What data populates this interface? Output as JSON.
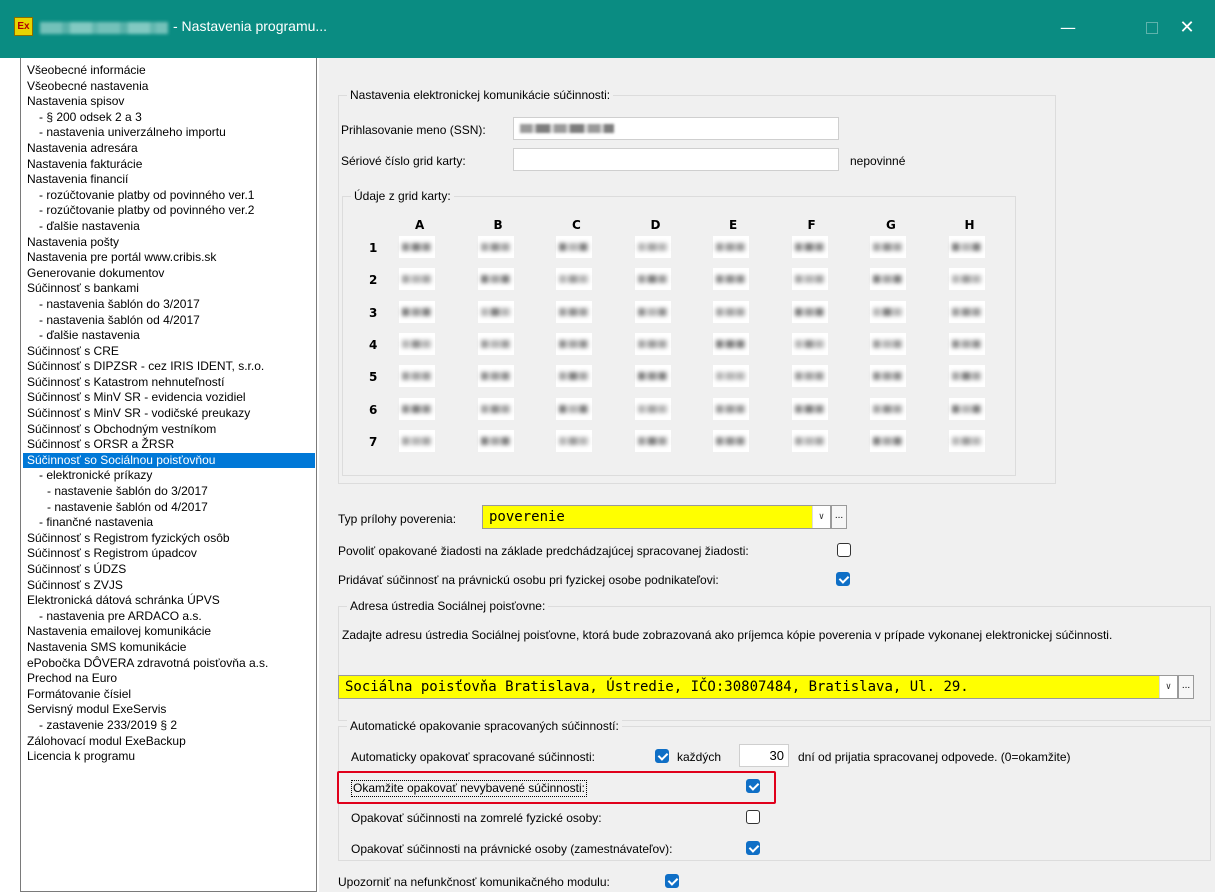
{
  "window": {
    "title": "- Nastavenia programu...",
    "app_icon_text": "Ex",
    "buttons": {
      "minimize": "—",
      "close": "✕"
    }
  },
  "tree": {
    "items": [
      {
        "label": "Všeobecné informácie",
        "level": 0
      },
      {
        "label": "Všeobecné nastavenia",
        "level": 0
      },
      {
        "label": "Nastavenia spisov",
        "level": 0
      },
      {
        "label": "- § 200 odsek 2 a 3",
        "level": 1
      },
      {
        "label": "- nastavenia univerzálneho importu",
        "level": 1
      },
      {
        "label": "Nastavenia adresára",
        "level": 0
      },
      {
        "label": "Nastavenia fakturácie",
        "level": 0
      },
      {
        "label": "Nastavenia financií",
        "level": 0
      },
      {
        "label": "- rozúčtovanie platby od povinného ver.1",
        "level": 1
      },
      {
        "label": "- rozúčtovanie platby od povinného ver.2",
        "level": 1
      },
      {
        "label": "- ďalšie nastavenia",
        "level": 1
      },
      {
        "label": "Nastavenia pošty",
        "level": 0
      },
      {
        "label": "Nastavenia pre portál www.cribis.sk",
        "level": 0
      },
      {
        "label": "Generovanie dokumentov",
        "level": 0
      },
      {
        "label": "Súčinnosť s bankami",
        "level": 0
      },
      {
        "label": "- nastavenia šablón do 3/2017",
        "level": 1
      },
      {
        "label": "- nastavenia šablón od 4/2017",
        "level": 1
      },
      {
        "label": "- ďalšie nastavenia",
        "level": 1
      },
      {
        "label": "Súčinnosť s CRE",
        "level": 0
      },
      {
        "label": "Súčinnosť s DIPZSR - cez IRIS IDENT, s.r.o.",
        "level": 0
      },
      {
        "label": "Súčinnosť s Katastrom nehnuteľností",
        "level": 0
      },
      {
        "label": "Súčinnosť s MinV SR - evidencia vozidiel",
        "level": 0
      },
      {
        "label": "Súčinnosť s MinV SR - vodičské preukazy",
        "level": 0
      },
      {
        "label": "Súčinnosť s Obchodným vestníkom",
        "level": 0
      },
      {
        "label": "Súčinnosť s ORSR a ŽRSR",
        "level": 0
      },
      {
        "label": "Súčinnosť so Sociálnou poisťovňou",
        "level": 0,
        "selected": true
      },
      {
        "label": "- elektronické príkazy",
        "level": 1
      },
      {
        "label": "- nastavenie šablón do 3/2017",
        "level": 2
      },
      {
        "label": "- nastavenie šablón od 4/2017",
        "level": 2
      },
      {
        "label": "- finančné nastavenia",
        "level": 1
      },
      {
        "label": "Súčinnosť s Registrom fyzických osôb",
        "level": 0
      },
      {
        "label": "Súčinnosť s Registrom úpadcov",
        "level": 0
      },
      {
        "label": "Súčinnosť s ÚDZS",
        "level": 0
      },
      {
        "label": "Súčinnosť s ZVJS",
        "level": 0
      },
      {
        "label": "Elektronická dátová schránka ÚPVS",
        "level": 0
      },
      {
        "label": "- nastavenia pre ARDACO a.s.",
        "level": 1
      },
      {
        "label": "Nastavenia emailovej komunikácie",
        "level": 0
      },
      {
        "label": "Nastavenia SMS komunikácie",
        "level": 0
      },
      {
        "label": "ePobočka DÔVERA zdravotná poisťovňa a.s.",
        "level": 0
      },
      {
        "label": "Prechod na Euro",
        "level": 0
      },
      {
        "label": "Formátovanie čísiel",
        "level": 0
      },
      {
        "label": "Servisný modul ExeServis",
        "level": 0
      },
      {
        "label": "- zastavenie 233/2019 § 2",
        "level": 1
      },
      {
        "label": "Zálohovací modul ExeBackup",
        "level": 0
      },
      {
        "label": "Licencia k programu",
        "level": 0
      }
    ]
  },
  "ecomm": {
    "title": "Nastavenia elektronickej komunikácie súčinnosti:",
    "login_label": "Prihlasovanie meno (SSN):",
    "serial_label": "Sériové číslo grid karty:",
    "serial_value": "",
    "optional_label": "nepovinné",
    "grid_title": "Údaje z grid karty:",
    "grid_columns": [
      "A",
      "B",
      "C",
      "D",
      "E",
      "F",
      "G",
      "H"
    ],
    "grid_rows": [
      "1",
      "2",
      "3",
      "4",
      "5",
      "6",
      "7"
    ]
  },
  "attachment": {
    "label": "Typ prílohy poverenia:",
    "value": "poverenie",
    "dots": "..."
  },
  "options": {
    "repeat_requests_label": "Povoliť opakované žiadosti na základe predchádzajúcej spracovanej žiadosti:",
    "repeat_requests_checked": false,
    "legal_person_label": "Pridávať súčinnosť na právnickú osobu pri fyzickej osobe podnikateľovi:",
    "legal_person_checked": true
  },
  "address": {
    "title": "Adresa ústredia Sociálnej poisťovne:",
    "description": "Zadajte adresu ústredia Sociálnej poisťovne, ktorá bude zobrazovaná ako príjemca kópie poverenia v prípade vykonanej elektronickej súčinnosti.",
    "value": "Sociálna poisťovňa Bratislava, Ústredie, IČO:30807484, Bratislava, Ul. 29.",
    "dots": "..."
  },
  "auto_repeat": {
    "title": "Automatické opakovanie spracovaných súčinností:",
    "auto_label": "Automaticky opakovať spracované súčinnosti:",
    "auto_checked": true,
    "every_label": "každých",
    "days_value": "30",
    "days_suffix": "dní od prijatia spracovanej odpovede. (0=okamžite)",
    "immediate_label": "Okamžite opakovať nevybavené súčinnosti:",
    "immediate_checked": true,
    "deceased_label": "Opakovať súčinnosti na zomrelé fyzické osoby:",
    "deceased_checked": false,
    "employers_label": "Opakovať súčinnosti na právnické osoby (zamestnávateľov):",
    "employers_checked": true
  },
  "notify": {
    "label": "Upozorniť na nefunkčnosť komunikačného modulu:",
    "checked": true
  },
  "colors": {
    "titlebar": "#0a8c82",
    "selection": "#0078d7",
    "highlight_field": "#ffff00",
    "checkbox_checked": "#0f6fc6",
    "annotation_box": "#e0001b"
  }
}
